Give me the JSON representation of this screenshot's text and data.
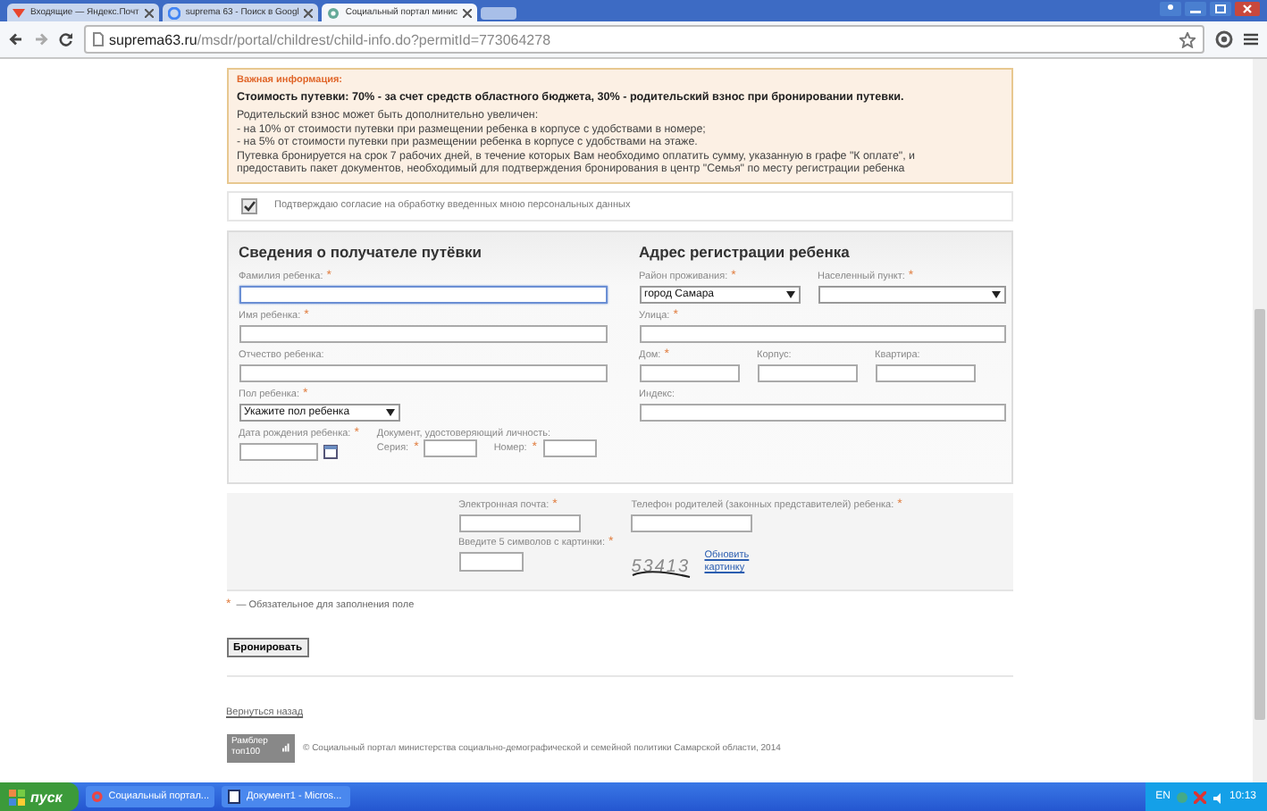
{
  "browser": {
    "tabs": [
      {
        "label": "Входящие — Яндекс.Почт",
        "selected": false,
        "kind": "mail"
      },
      {
        "label": "suprema 63 - Поиск в Googl",
        "selected": false,
        "kind": "google"
      },
      {
        "label": "Социальный портал минис",
        "selected": true,
        "kind": "site"
      }
    ],
    "url_host": "suprema63.ru",
    "url_path": "/msdr/portal/childrest/child-info.do?permitId=773064278"
  },
  "info": {
    "title": "Важная информация:",
    "lead": "Стоимость путевки: 70% - за счет средств областного бюджета, 30% - родительский взнос при бронировании путевки.",
    "lines": [
      "Родительский взнос может быть дополнительно увеличен:",
      "- на 10% от стоимости путевки при размещении ребенка в корпусе с удобствами в номере;",
      "- на 5% от стоимости путевки при размещении ребенка в корпусе с удобствами на этаже.",
      "Путевка бронируется на срок 7 рабочих дней, в течение которых Вам необходимо оплатить сумму, указанную в графе \"К оплате\", и",
      "предоставить пакет документов, необходимый для подтверждения бронирования в центр \"Семья\" по месту регистрации ребенка"
    ]
  },
  "consent": {
    "label": "Подтверждаю согласие на обработку введенных мною персональных данных",
    "checked": true
  },
  "recipient": {
    "heading": "Сведения о получателе путёвки",
    "rows": [
      [
        {
          "label": "Фамилия ребенка:",
          "mark": "*",
          "kind": "text",
          "focused": true
        }
      ],
      [
        {
          "label": "Имя ребенка:",
          "mark": "*",
          "kind": "text",
          "focused": false
        }
      ],
      [
        {
          "label": "Отчество ребенка:",
          "kind": "text",
          "focused": false
        }
      ],
      [
        {
          "label": "Пол ребенка:",
          "mark": "*",
          "kind": "select",
          "value": "Укажите пол ребенка"
        }
      ],
      [
        {
          "label": "Дата рождения ребенка:",
          "mark": "*",
          "kind": "date"
        },
        {
          "label": "Документ, удостоверяющий личность:",
          "kind": "doc",
          "parts": [
            {
              "label": "Серия:",
              "mark": "*"
            },
            {
              "label": "Номер:",
              "mark": "*"
            }
          ]
        }
      ]
    ]
  },
  "address": {
    "heading": "Адрес регистрации ребенка",
    "district": {
      "label": "Район проживания:",
      "mark": "*",
      "kind": "select",
      "value": "город Самара"
    },
    "settlement": {
      "label": "Населенный пункт:",
      "mark": "*",
      "kind": "select"
    },
    "street": {
      "label": "Улица:",
      "mark": "*",
      "kind": "text",
      "focused": false
    },
    "building": [
      {
        "label": "Дом:",
        "mark": "*",
        "kind": "short"
      },
      {
        "label": "Корпус:",
        "kind": "short"
      },
      {
        "label": "Квартира:",
        "kind": "short"
      }
    ],
    "postcode": {
      "label": "Индекс:",
      "kind": "text",
      "focused": false
    }
  },
  "contacts": {
    "email": {
      "label": "Электронная почта:",
      "mark": "*"
    },
    "phone": {
      "label": "Телефон родителей (законных представителей) ребенка:",
      "mark": "*"
    },
    "captcha": {
      "label": "Введите 5 символов с картинки:",
      "mark": "*",
      "code": "53413",
      "refresh": "Обновить картинку"
    }
  },
  "required_note": {
    "mark": "*",
    "text": "— Обязательное для заполнения поле"
  },
  "submit": "Бронировать",
  "back_link": "Вернуться назад",
  "footer": {
    "counter": "Рамблер топ100",
    "copyright": "© Социальный портал министерства социально-демографической и семейной политики Самарской области, 2014"
  },
  "taskbar": {
    "start": "пуск",
    "tasks": [
      {
        "label": "Социальный портал...",
        "kind": "browser",
        "selected": false
      },
      {
        "label": "Документ1 - Micros...",
        "kind": "doc",
        "selected": false
      }
    ],
    "lang": "EN",
    "time": "10:13"
  }
}
